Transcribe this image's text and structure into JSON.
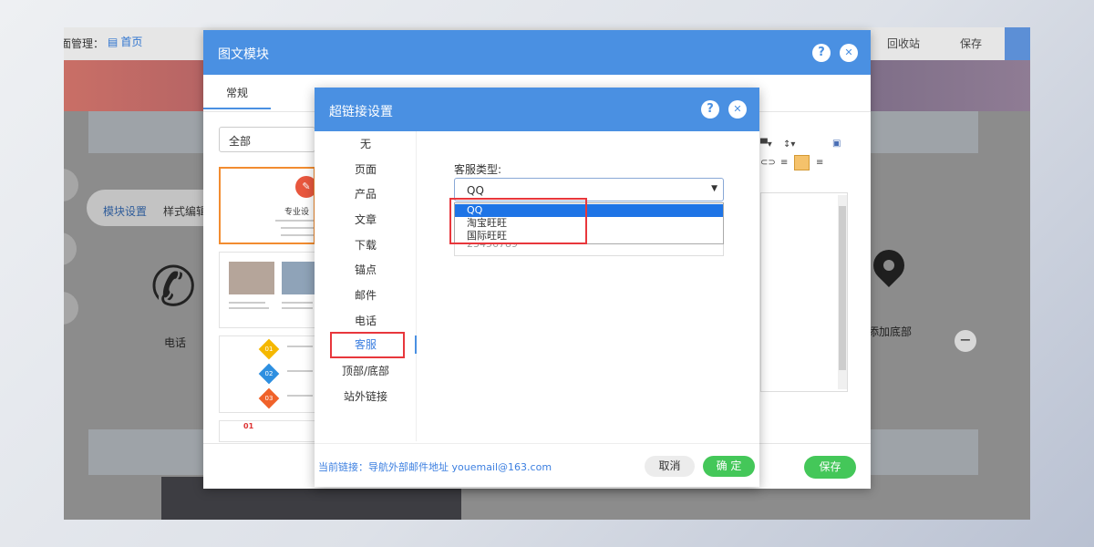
{
  "topbar": {
    "title": "页面管理：",
    "home_icon": "page-icon",
    "home_label": "首页",
    "recycle_label": "回收站",
    "save_label": "保存"
  },
  "background": {
    "tabs": [
      "模块设置",
      "样式编辑"
    ],
    "phone_label": "电话",
    "map_label": "添加底部"
  },
  "outer_dialog": {
    "title": "图文模块",
    "help_icon": "?",
    "close_icon": "✕",
    "tab": "常规",
    "filter_value": "全部",
    "templates": [
      {
        "title": "专业设"
      },
      {
        "title": ""
      },
      {
        "items": [
          "01",
          "02",
          "03"
        ],
        "colors": [
          "#f5b800",
          "#2e8fe0",
          "#f0622a"
        ]
      },
      {
        "num": "01"
      }
    ],
    "save_label": "保存"
  },
  "link_dialog": {
    "title": "超链接设置",
    "help_icon": "?",
    "close_icon": "✕",
    "nav": [
      "无",
      "页面",
      "产品",
      "文章",
      "下载",
      "锚点",
      "邮件",
      "电话",
      "客服",
      "顶部/底部",
      "站外链接"
    ],
    "active_nav": "客服",
    "kefu_type_label": "客服类型:",
    "kefu_selected": "QQ",
    "kefu_options": [
      "QQ",
      "淘宝旺旺",
      "国际旺旺"
    ],
    "underlying_input_value": "23456789",
    "current_link": "当前链接：导航外部邮件地址 youemail@163.com",
    "cancel_label": "取消",
    "ok_label": "确 定"
  },
  "colors": {
    "dialog_header": "#4a90e2",
    "ok_green": "#44c759",
    "highlight_red": "#e8373c",
    "selected_option": "#1e74e6"
  }
}
